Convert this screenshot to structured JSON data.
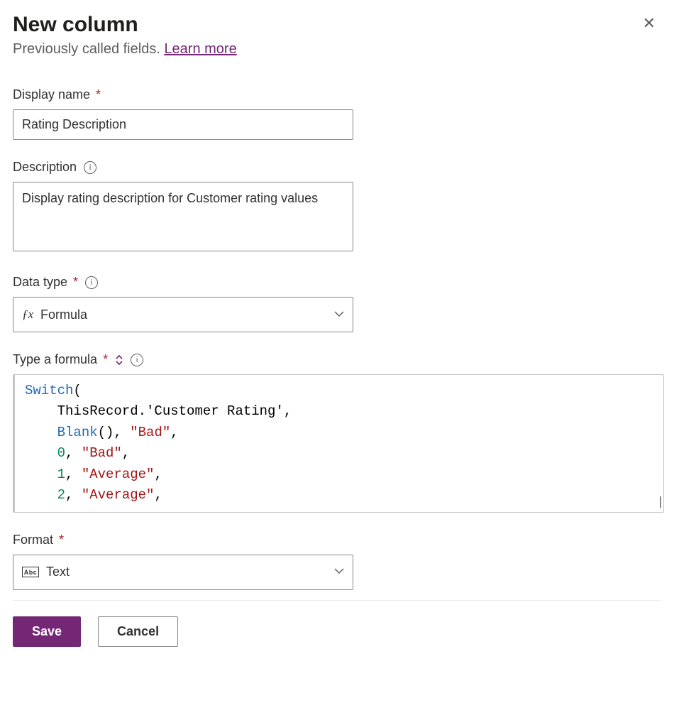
{
  "header": {
    "title": "New column",
    "subtitle_prefix": "Previously called fields. ",
    "learn_more": "Learn more"
  },
  "fields": {
    "display_name": {
      "label": "Display name",
      "value": "Rating Description"
    },
    "description": {
      "label": "Description",
      "value": "Display rating description for Customer rating values"
    },
    "data_type": {
      "label": "Data type",
      "value": "Formula"
    },
    "formula": {
      "label": "Type a formula",
      "tokens": {
        "fn_switch": "Switch",
        "open_paren": "(",
        "line1": "ThisRecord.'Customer Rating',",
        "fn_blank": "Blank",
        "blank_tail": "(), ",
        "str_bad": "\"Bad\"",
        "comma": ",",
        "num0": "0",
        "num1": "1",
        "num2": "2",
        "str_average": "\"Average\"",
        "sep": ", "
      }
    },
    "format": {
      "label": "Format",
      "value": "Text"
    }
  },
  "footer": {
    "save": "Save",
    "cancel": "Cancel"
  }
}
